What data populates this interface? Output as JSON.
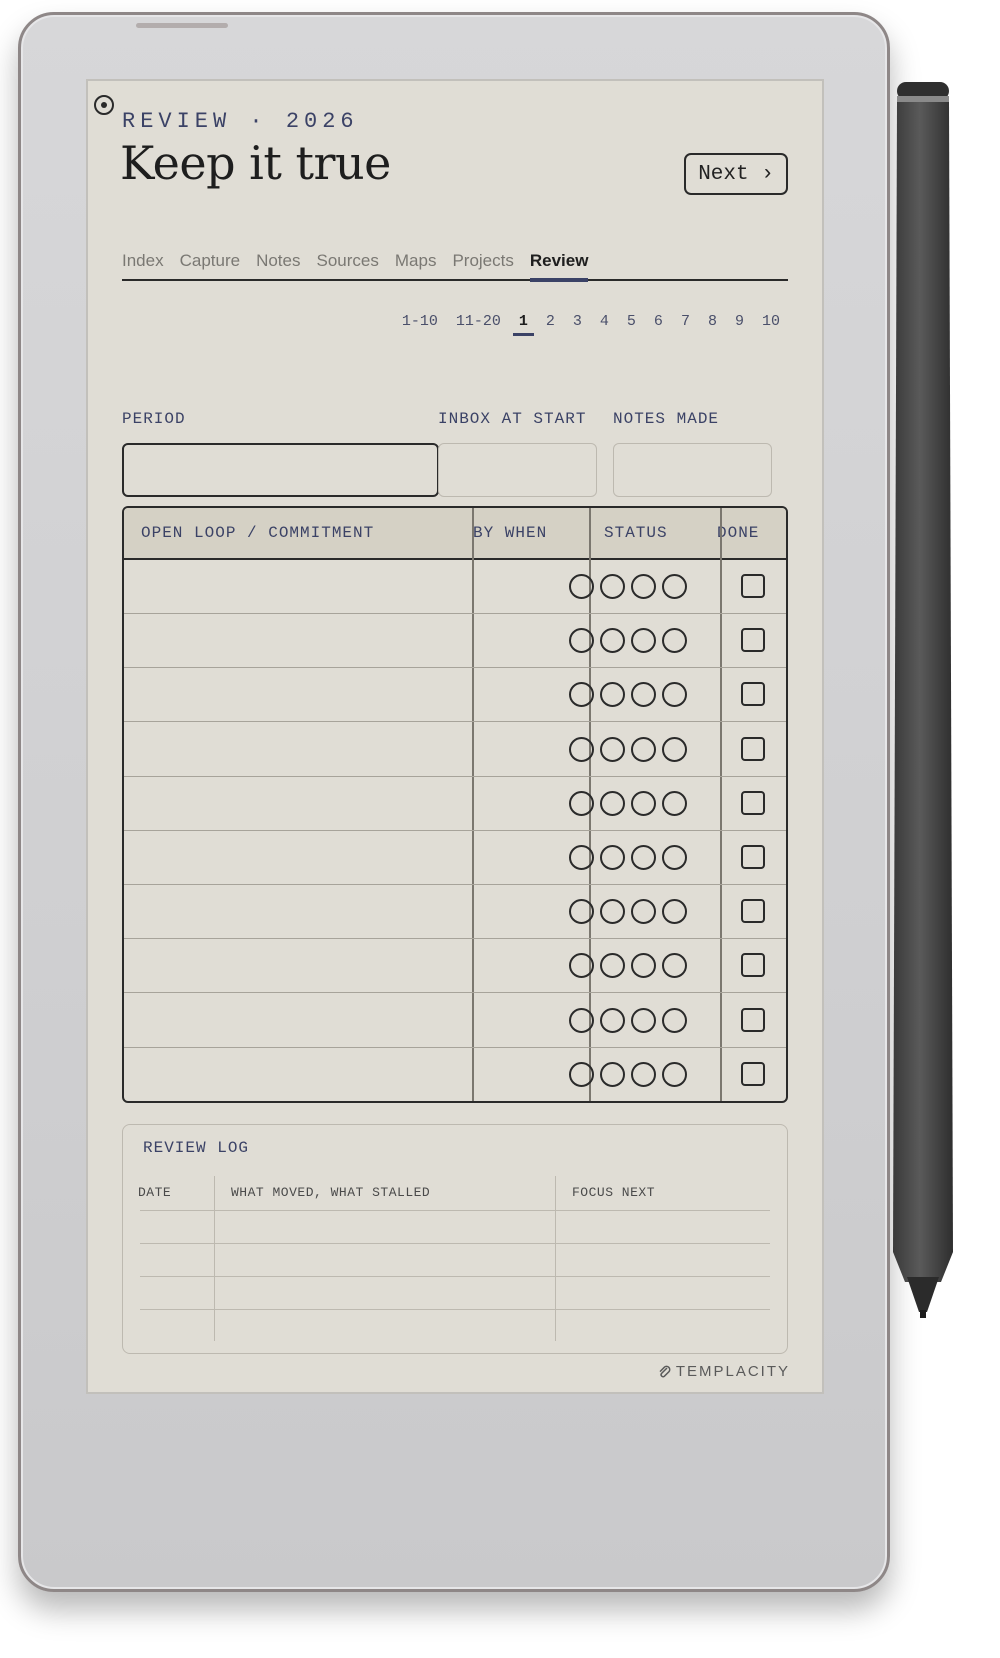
{
  "header": {
    "eyebrow": "REVIEW · 2026",
    "title": "Keep it true",
    "next_label": "Next ›"
  },
  "tabs": [
    {
      "label": "Index"
    },
    {
      "label": "Capture"
    },
    {
      "label": "Notes"
    },
    {
      "label": "Sources"
    },
    {
      "label": "Maps"
    },
    {
      "label": "Projects"
    },
    {
      "label": "Review",
      "active": true
    }
  ],
  "pager": {
    "items": [
      "1-10",
      "11-20",
      "1",
      "2",
      "3",
      "4",
      "5",
      "6",
      "7",
      "8",
      "9",
      "10"
    ],
    "current": "1"
  },
  "fields": {
    "period_label": "PERIOD",
    "inbox_label": "INBOX AT START",
    "notes_label": "NOTES MADE"
  },
  "loop_table": {
    "headers": {
      "commitment": "OPEN LOOP / COMMITMENT",
      "by_when": "BY WHEN",
      "status": "STATUS",
      "done": "DONE"
    },
    "row_count": 10,
    "status_circles_per_row": 4
  },
  "review_log": {
    "title": "REVIEW LOG",
    "col_date": "DATE",
    "col_moved": "WHAT MOVED, WHAT STALLED",
    "col_focus": "FOCUS NEXT"
  },
  "brand": {
    "name": "TEMPLACITY",
    "icon": "paperclip-icon"
  }
}
